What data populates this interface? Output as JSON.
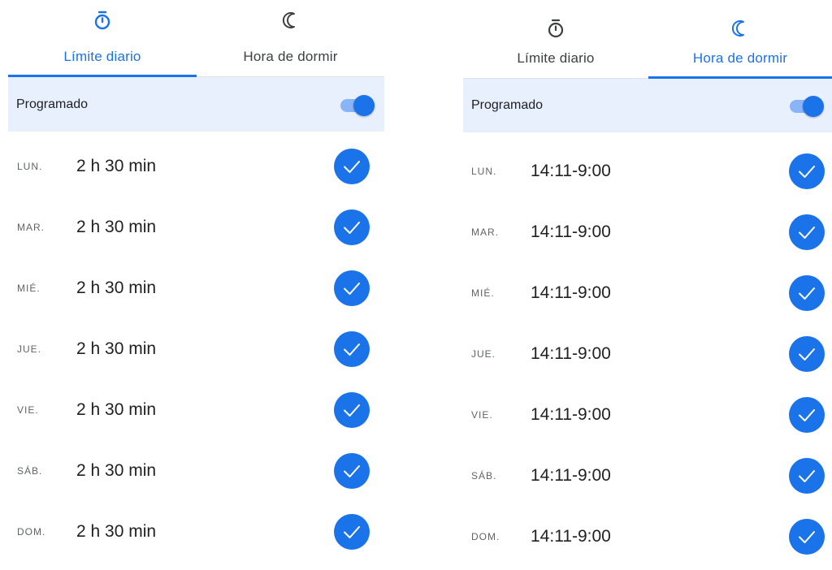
{
  "colors": {
    "accent": "#1a73e8",
    "schedule_bg": "#e8f0fe"
  },
  "panels": [
    {
      "tabs": [
        {
          "label": "Límite diario",
          "icon": "stopwatch-icon",
          "active": true
        },
        {
          "label": "Hora de dormir",
          "icon": "moon-icon",
          "active": false
        }
      ],
      "schedule": {
        "label": "Programado",
        "enabled": true
      },
      "rows": [
        {
          "day": "LUN.",
          "value": "2 h 30 min",
          "checked": true
        },
        {
          "day": "MAR.",
          "value": "2 h 30 min",
          "checked": true
        },
        {
          "day": "MIÉ.",
          "value": "2 h 30 min",
          "checked": true
        },
        {
          "day": "JUE.",
          "value": "2 h 30 min",
          "checked": true
        },
        {
          "day": "VIE.",
          "value": "2 h 30 min",
          "checked": true
        },
        {
          "day": "SÁB.",
          "value": "2 h 30 min",
          "checked": true
        },
        {
          "day": "DOM.",
          "value": "2 h 30 min",
          "checked": true
        }
      ]
    },
    {
      "tabs": [
        {
          "label": "Límite diario",
          "icon": "stopwatch-icon",
          "active": false
        },
        {
          "label": "Hora de dormir",
          "icon": "moon-icon",
          "active": true
        }
      ],
      "schedule": {
        "label": "Programado",
        "enabled": true
      },
      "rows": [
        {
          "day": "LUN.",
          "value": "14:11-9:00",
          "checked": true
        },
        {
          "day": "MAR.",
          "value": "14:11-9:00",
          "checked": true
        },
        {
          "day": "MIÉ.",
          "value": "14:11-9:00",
          "checked": true
        },
        {
          "day": "JUE.",
          "value": "14:11-9:00",
          "checked": true
        },
        {
          "day": "VIE.",
          "value": "14:11-9:00",
          "checked": true
        },
        {
          "day": "SÁB.",
          "value": "14:11-9:00",
          "checked": true
        },
        {
          "day": "DOM.",
          "value": "14:11-9:00",
          "checked": true
        }
      ]
    }
  ]
}
